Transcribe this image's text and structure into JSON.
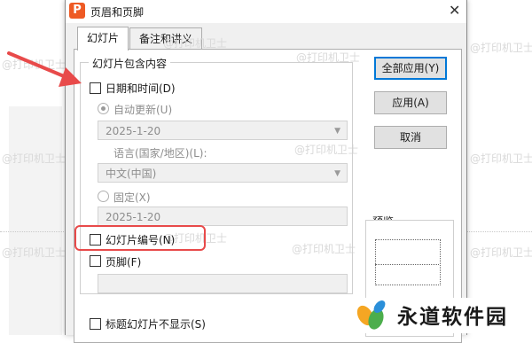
{
  "dialog": {
    "app_icon_letter": "P",
    "title": "页眉和页脚",
    "close_glyph": "✕",
    "tabs": [
      {
        "label": "幻灯片",
        "active": true
      },
      {
        "label": "备注和讲义",
        "active": false
      }
    ],
    "group_title": "幻灯片包含内容",
    "date_time": {
      "label": "日期和时间(D)",
      "checked": false
    },
    "auto_update": {
      "label": "自动更新(U)",
      "selected": true
    },
    "auto_update_value": "2025-1-20",
    "language_label": "语言(国家/地区)(L):",
    "language_value": "中文(中国)",
    "fixed": {
      "label": "固定(X)",
      "selected": false
    },
    "fixed_value": "2025-1-20",
    "slide_number": {
      "label": "幻灯片编号(N)",
      "checked": false
    },
    "footer": {
      "label": "页脚(F)",
      "checked": false
    },
    "footer_value": "",
    "hide_title": {
      "label": "标题幻灯片不显示(S)",
      "checked": false
    },
    "buttons": {
      "apply_all": "全部应用(Y)",
      "apply": "应用(A)",
      "cancel": "取消"
    },
    "preview_label": "预览"
  },
  "watermark_text": "@打印机卫士",
  "logo": {
    "text": "永道软件园",
    "colors": [
      "#f5a623",
      "#4cae4c",
      "#2b8fd9"
    ]
  },
  "annotation": {
    "highlight_color": "#e84a4a",
    "arrow_color": "#e84a4a"
  }
}
